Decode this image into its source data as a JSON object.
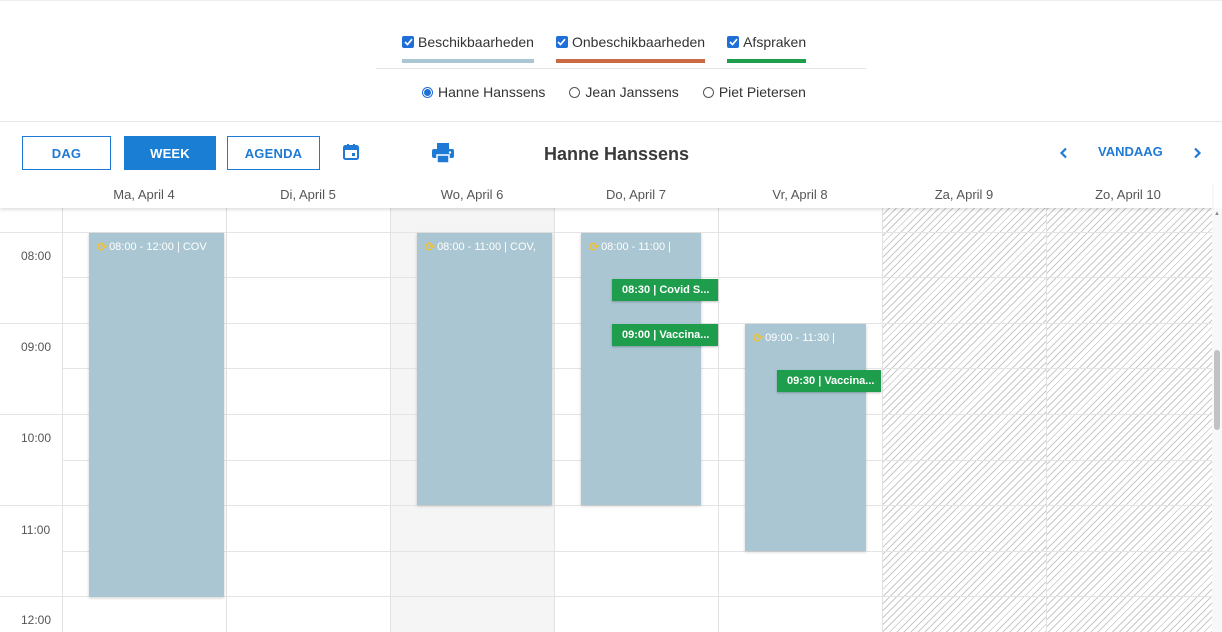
{
  "filters": {
    "checkboxes": [
      {
        "label": "Beschikbaarheden",
        "checked": true,
        "color": "#a9c6d2"
      },
      {
        "label": "Onbeschikbaarheden",
        "checked": true,
        "color": "#c96a44"
      },
      {
        "label": "Afspraken",
        "checked": true,
        "color": "#1e9e4c"
      }
    ],
    "people": [
      {
        "label": "Hanne Hanssens",
        "selected": true
      },
      {
        "label": "Jean Janssens",
        "selected": false
      },
      {
        "label": "Piet Pietersen",
        "selected": false
      }
    ]
  },
  "toolbar": {
    "day_label": "DAG",
    "week_label": "WEEK",
    "agenda_label": "AGENDA",
    "active_view": "WEEK",
    "calendar_icon": "calendar-icon",
    "print_icon": "printer-icon",
    "title": "Hanne Hanssens",
    "today_label": "VANDAAG",
    "prev_icon": "chevron-left-icon",
    "next_icon": "chevron-right-icon"
  },
  "days": [
    {
      "label": "Ma, April 4"
    },
    {
      "label": "Di, April 5"
    },
    {
      "label": "Wo, April 6",
      "today": true
    },
    {
      "label": "Do, April 7"
    },
    {
      "label": "Vr, April 8"
    },
    {
      "label": "Za, April 9",
      "weekend": true
    },
    {
      "label": "Zo, April 10",
      "weekend": true
    }
  ],
  "hours": [
    "08:00",
    "09:00",
    "10:00",
    "11:00",
    "12:00"
  ],
  "availabilities": [
    {
      "day": 0,
      "start": "08:00",
      "end": "12:00",
      "label": "08:00 - 12:00 | COV",
      "recurring": true
    },
    {
      "day": 2,
      "start": "08:00",
      "end": "11:00",
      "label": "08:00 - 11:00 | COV,",
      "recurring": true
    },
    {
      "day": 3,
      "start": "08:00",
      "end": "11:00",
      "label": "08:00 - 11:00 |",
      "recurring": true
    },
    {
      "day": 4,
      "start": "09:00",
      "end": "11:30",
      "label": "09:00 - 11:30 |",
      "recurring": true
    }
  ],
  "appointments": [
    {
      "day": 3,
      "start": "08:30",
      "label": "08:30 | Covid S..."
    },
    {
      "day": 3,
      "start": "09:00",
      "label": "09:00 | Vaccina..."
    },
    {
      "day": 4,
      "start": "09:30",
      "label": "09:30 | Vaccina..."
    }
  ],
  "colors": {
    "accent": "#1f7ad6",
    "availability": "#a9c6d2",
    "appointment": "#1e9e4c",
    "recurring_icon": "#f3c22e"
  },
  "recurring_icon": "refresh-icon"
}
